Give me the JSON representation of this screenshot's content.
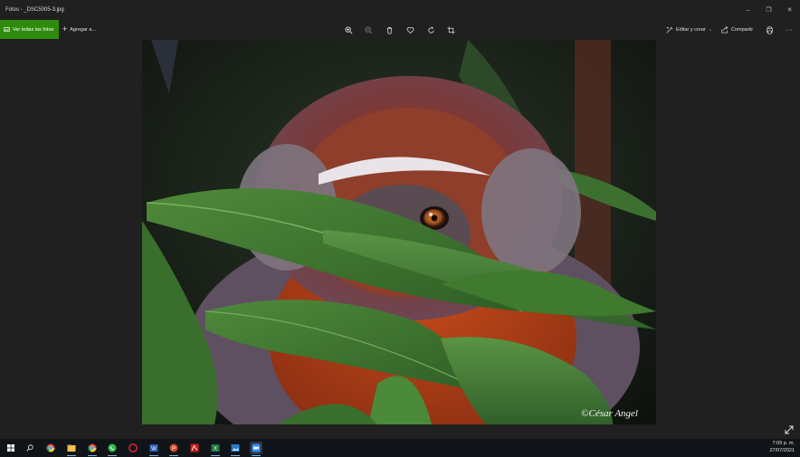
{
  "window": {
    "title": "Fotos - _DSC5005-3.jpg",
    "minimize_glyph": "–",
    "restore_glyph": "❐",
    "close_glyph": "✕"
  },
  "toolbar": {
    "view_all_label": "Ver todas las fotos",
    "add_label": "Agregar a...",
    "edit_label": "Editar y crear",
    "share_label": "Compartir",
    "more_glyph": "···",
    "tools": [
      "zoom-in-icon",
      "zoom-out-icon",
      "delete-icon",
      "favorite-icon",
      "rotate-icon",
      "crop-icon"
    ]
  },
  "photo": {
    "watermark": "©César Angel"
  },
  "taskbar": {
    "icons": [
      "windows-start-icon",
      "search-icon",
      "chrome-icon",
      "file-explorer-icon",
      "chrome-icon",
      "whatsapp-icon",
      "opera-icon",
      "word-icon",
      "powerpoint-icon",
      "acrobat-icon",
      "excel-icon",
      "photos-icon",
      "zoom-icon"
    ],
    "time": "7:09 p. m.",
    "date": "27/07/2021"
  },
  "colors": {
    "accent_green": "#2e8b0e",
    "background": "#202020",
    "taskbar": "#101418"
  }
}
